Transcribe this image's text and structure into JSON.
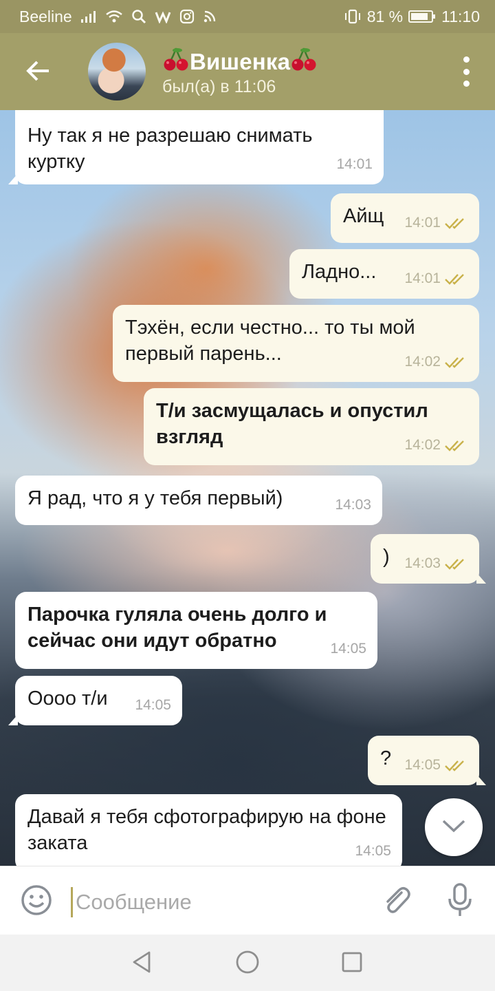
{
  "status_bar": {
    "carrier": "Beeline",
    "battery": "81 %",
    "time": "11:10"
  },
  "header": {
    "back_icon": "arrow-left-icon",
    "contact_name": "Вишенка",
    "name_decoration_icon": "cherry-icon",
    "last_seen": "был(а) в 11:06",
    "menu_icon": "more-vert-icon"
  },
  "messages": [
    {
      "dir": "in",
      "text": "Ну так я не разрешаю снимать куртку",
      "time": "14:01",
      "bold": false
    },
    {
      "dir": "out",
      "text": "Айщ",
      "time": "14:01",
      "read": true,
      "bold": false
    },
    {
      "dir": "out",
      "text": "Ладно...",
      "time": "14:01",
      "read": true,
      "bold": false
    },
    {
      "dir": "out",
      "text": "Тэхён, если честно... то ты мой первый парень...",
      "time": "14:02",
      "read": true,
      "bold": false
    },
    {
      "dir": "out",
      "text": "Т/и засмущалась и опустил взгляд",
      "time": "14:02",
      "read": true,
      "bold": true
    },
    {
      "dir": "in",
      "text": "Я рад, что я у тебя первый)",
      "time": "14:03",
      "bold": false
    },
    {
      "dir": "out",
      "text": ")",
      "time": "14:03",
      "read": true,
      "bold": false
    },
    {
      "dir": "in",
      "text": "Парочка гуляла очень долго и сейчас они идут обратно",
      "time": "14:05",
      "bold": true
    },
    {
      "dir": "in",
      "text": "Оооо т/и",
      "time": "14:05",
      "bold": false
    },
    {
      "dir": "out",
      "text": "?",
      "time": "14:05",
      "read": true,
      "bold": false
    },
    {
      "dir": "in",
      "text": "Давай я тебя сфотографирую на фоне заката",
      "time": "14:05",
      "bold": false
    }
  ],
  "composer": {
    "placeholder": "Сообщение",
    "emoji_icon": "smile-icon",
    "attach_icon": "paperclip-icon",
    "mic_icon": "microphone-icon"
  },
  "scroll_down_icon": "chevron-down-icon",
  "colors": {
    "header": "#a39f69",
    "status_bar": "#9a9563",
    "bubble_in": "#ffffff",
    "bubble_out": "#fbf8e9",
    "read_check": "#c9b24a"
  }
}
